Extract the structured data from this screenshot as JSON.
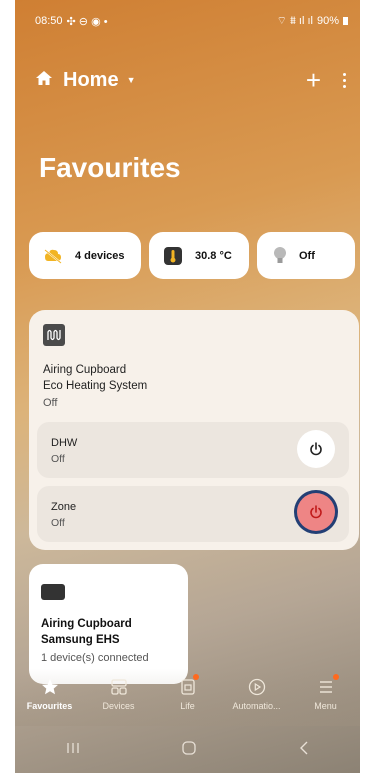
{
  "status_bar": {
    "time": "08:50",
    "left_icons": "✣ ⊖ ◉ •",
    "signal": "⌔ ⩩ ıl ıl",
    "battery": "90%"
  },
  "header": {
    "title": "Home"
  },
  "page_title": "Favourites",
  "chips": [
    {
      "icon": "devices-cloud-icon",
      "label": "4 devices"
    },
    {
      "icon": "thermometer-icon",
      "label": "30.8 °C"
    },
    {
      "icon": "bulb-icon",
      "label": "Off"
    }
  ],
  "ehs_card": {
    "name_line1": "Airing Cupboard",
    "name_line2": "Eco Heating System",
    "status": "Off",
    "zones": [
      {
        "name": "DHW",
        "state": "Off"
      },
      {
        "name": "Zone",
        "state": "Off"
      }
    ]
  },
  "samsung_card": {
    "name_line1": "Airing Cupboard",
    "name_line2": "Samsung EHS",
    "subtitle": "1 device(s) connected"
  },
  "bottom_nav": [
    {
      "label": "Favourites",
      "icon": "star-icon",
      "active": true
    },
    {
      "label": "Devices",
      "icon": "grid-icon"
    },
    {
      "label": "Life",
      "icon": "life-icon",
      "badge": true
    },
    {
      "label": "Automatio...",
      "icon": "automation-icon"
    },
    {
      "label": "Menu",
      "icon": "menu-icon",
      "badge": true
    }
  ],
  "colors": {
    "accent_power": "#ee8585",
    "power_ring": "#233f75",
    "badge": "#ff6a1f"
  }
}
